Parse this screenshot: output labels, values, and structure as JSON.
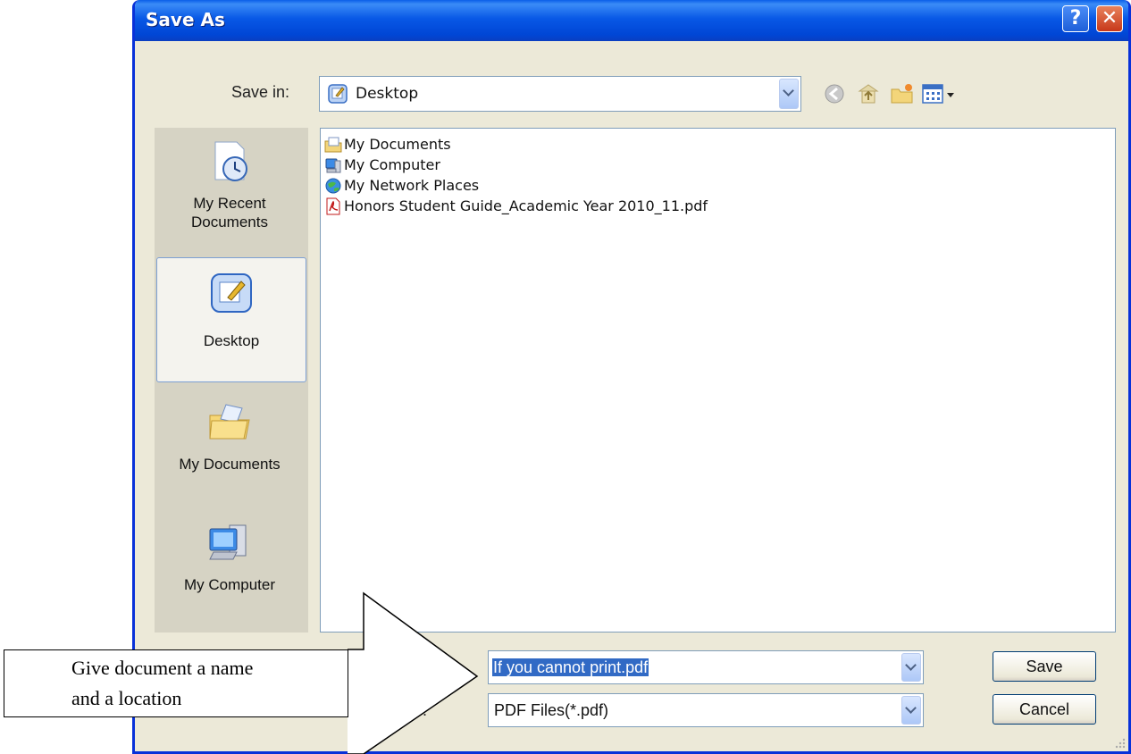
{
  "window": {
    "title": "Save As",
    "help_label": "?",
    "close_label": "✕"
  },
  "save_in": {
    "label": "Save in:",
    "value": "Desktop"
  },
  "toolbar": {
    "icons": [
      "back-icon",
      "up-folder-icon",
      "new-folder-icon",
      "views-menu-icon"
    ]
  },
  "places": [
    {
      "label": "My Recent Documents",
      "line1": "My Recent",
      "line2": "Documents",
      "icon": "recent-documents-icon"
    },
    {
      "label": "Desktop",
      "icon": "desktop-icon",
      "selected": true
    },
    {
      "label": "My Documents",
      "icon": "my-documents-icon"
    },
    {
      "label": "My Computer",
      "icon": "my-computer-icon"
    }
  ],
  "files": [
    {
      "name": "My Documents",
      "icon": "my-documents-folder-icon"
    },
    {
      "name": "My Computer",
      "icon": "my-computer-icon"
    },
    {
      "name": "My Network Places",
      "icon": "network-places-icon"
    },
    {
      "name": "Honors Student Guide_Academic Year 2010_11.pdf",
      "icon": "pdf-file-icon"
    }
  ],
  "file_name": {
    "label_partial": "",
    "value": "If you cannot print.pdf"
  },
  "save_as_type": {
    "label_partial": "e:",
    "value": "PDF Files(*.pdf)"
  },
  "buttons": {
    "save": "Save",
    "cancel": "Cancel"
  },
  "callout": {
    "line1": "Give document a name",
    "line2": "and a location"
  },
  "colors": {
    "title_bar": "#0858e6",
    "dialog_bg": "#ece9d8",
    "selection": "#316ac5"
  }
}
